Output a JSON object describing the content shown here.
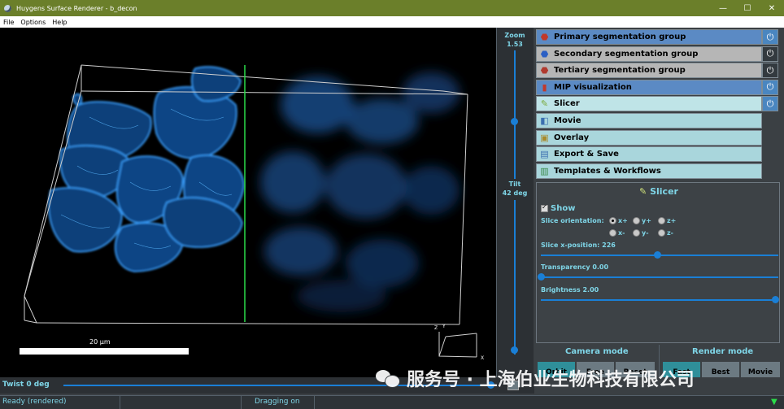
{
  "window": {
    "title": "Huygens Surface Renderer - b_decon",
    "minimize": "—",
    "maximize": "☐",
    "close": "✕"
  },
  "menu": [
    "File",
    "Options",
    "Help"
  ],
  "viewport": {
    "scalebar_label": "20 µm",
    "axes": {
      "x": "X",
      "y": "Y",
      "z": "Z"
    }
  },
  "zoom": {
    "label": "Zoom",
    "value": "1.53",
    "level": 0.55
  },
  "tilt": {
    "label": "Tilt",
    "value": "42 deg",
    "level": 0.97
  },
  "twist": {
    "label": "Twist 0 deg",
    "level": 0.99
  },
  "panel": {
    "items": [
      {
        "label": "Primary segmentation group",
        "icon": "primary-segmentation-icon",
        "style": "blue",
        "power": "on"
      },
      {
        "label": "Secondary segmentation group",
        "icon": "secondary-segmentation-icon",
        "style": "grey",
        "power": "off"
      },
      {
        "label": "Tertiary segmentation group",
        "icon": "tertiary-segmentation-icon",
        "style": "grey",
        "power": "off"
      },
      {
        "label": "MIP visualization",
        "icon": "mip-visualization-icon",
        "style": "blue",
        "power": "on"
      },
      {
        "label": "Slicer",
        "icon": "slicer-icon",
        "style": "pale",
        "power": "on"
      },
      {
        "label": "Movie",
        "icon": "movie-icon",
        "style": "light"
      },
      {
        "label": "Overlay",
        "icon": "overlay-icon",
        "style": "light"
      },
      {
        "label": "Export & Save",
        "icon": "export-save-icon",
        "style": "light"
      },
      {
        "label": "Templates & Workflows",
        "icon": "templates-workflows-icon",
        "style": "light"
      }
    ],
    "power_symbol": "⏻"
  },
  "slicer": {
    "title": "Slicer",
    "show_label": "Show",
    "orientation_label": "Slice orientation:",
    "orientations": [
      "x+",
      "y+",
      "z+",
      "x-",
      "y-",
      "z-"
    ],
    "selected_orientation": "x+",
    "position_label": "Slice x-position: 226",
    "position_level": 0.49,
    "transparency_label": "Transparency 0.00",
    "transparency_level": 0.0,
    "brightness_label": "Brightness 2.00",
    "brightness_level": 1.0
  },
  "modes": {
    "camera_title": "Camera mode",
    "render_title": "Render mode",
    "buttons": [
      "Orbit",
      "Free",
      "Reset",
      "Fast",
      "Best",
      "Movie"
    ]
  },
  "status": {
    "left": "Ready (rendered)",
    "middle": "Dragging on"
  },
  "watermark": "服务号 · 上海伯业生物科技有限公司",
  "colors": {
    "accent": "#1a7fd6",
    "label": "#7fd6e8",
    "titlebar": "#6b7f2a",
    "cell": "#1e7fe0",
    "slice": "#2bdc4a"
  }
}
